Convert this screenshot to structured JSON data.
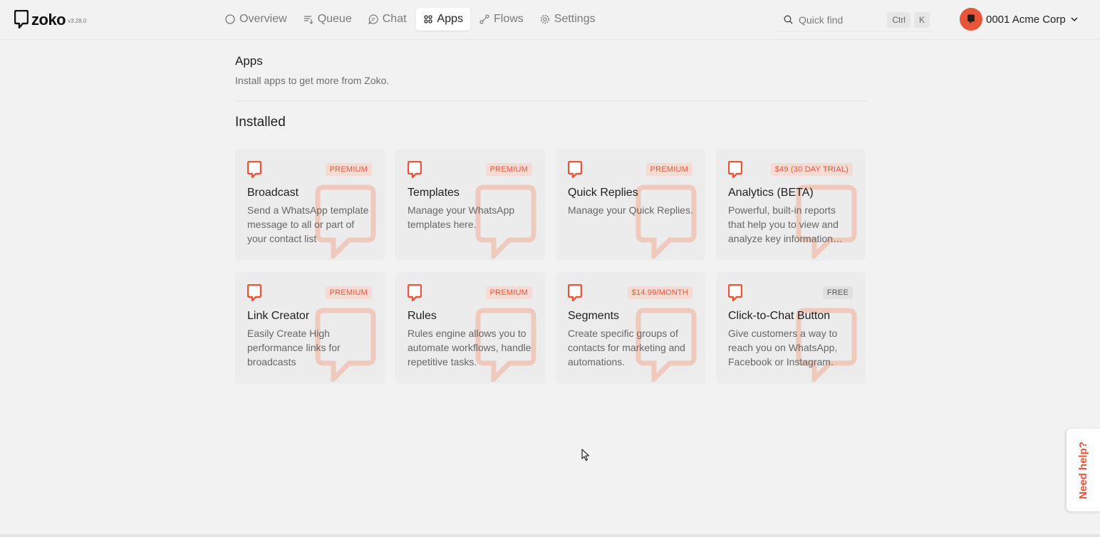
{
  "app": {
    "name": "zoko",
    "version": "v3.28.0",
    "brand_color": "#e8563a"
  },
  "nav": {
    "items": [
      {
        "label": "Overview",
        "icon": "circle-icon",
        "active": false
      },
      {
        "label": "Queue",
        "icon": "queue-list-icon",
        "active": false
      },
      {
        "label": "Chat",
        "icon": "chat-bubble-icon",
        "active": false
      },
      {
        "label": "Apps",
        "icon": "apps-grid-icon",
        "active": true
      },
      {
        "label": "Flows",
        "icon": "flow-icon",
        "active": false
      },
      {
        "label": "Settings",
        "icon": "gear-icon",
        "active": false
      }
    ]
  },
  "search": {
    "label": "Quick find",
    "shortcut_keys": [
      "Ctrl",
      "K"
    ]
  },
  "account": {
    "name": "0001 Acme Corp"
  },
  "page": {
    "title": "Apps",
    "subtitle": "Install apps to get more from Zoko.",
    "section_title": "Installed"
  },
  "apps": [
    {
      "title": "Broadcast",
      "badge": "PREMIUM",
      "badge_type": "paid",
      "description": "Send a WhatsApp template message to all or part of your contact list"
    },
    {
      "title": "Templates",
      "badge": "PREMIUM",
      "badge_type": "paid",
      "description": "Manage your WhatsApp templates here."
    },
    {
      "title": "Quick Replies",
      "badge": "PREMIUM",
      "badge_type": "paid",
      "description": "Manage your Quick Replies."
    },
    {
      "title": "Analytics (BETA)",
      "badge": "$49 (30 DAY TRIAL)",
      "badge_type": "paid",
      "description": "Powerful, built-in reports that help you to view and analyze key information about your business"
    },
    {
      "title": "Link Creator",
      "badge": "PREMIUM",
      "badge_type": "paid",
      "description": "Easily Create High performance links for broadcasts"
    },
    {
      "title": "Rules",
      "badge": "PREMIUM",
      "badge_type": "paid",
      "description": "Rules engine allows you to automate workflows, handle repetitive tasks."
    },
    {
      "title": "Segments",
      "badge": "$14.99/MONTH",
      "badge_type": "paid",
      "description": "Create specific groups of contacts for marketing and automations."
    },
    {
      "title": "Click-to-Chat Button",
      "badge": "FREE",
      "badge_type": "free",
      "description": "Give customers a way to reach you on WhatsApp, Facebook or Instagram."
    }
  ],
  "help": {
    "label": "Need help?"
  }
}
